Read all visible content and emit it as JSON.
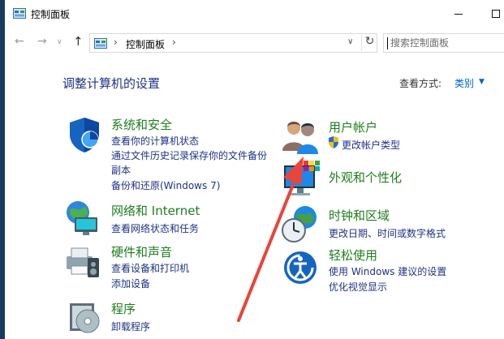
{
  "window": {
    "title": "控制面板",
    "title_icon": "control-panel-icon",
    "controls": [
      "minimize-icon",
      "maximize-icon"
    ]
  },
  "navigation": {
    "back_icon": "back-arrow-icon",
    "forward_icon": "forward-arrow-icon",
    "up_icon": "up-arrow-icon",
    "breadcrumb": "控制面板",
    "search_placeholder": "搜索控制面板"
  },
  "main": {
    "heading": "调整计算机的设置",
    "view_by_label": "查看方式:",
    "view_by_value": "类别"
  },
  "left_categories": [
    {
      "icon": "shield-icon",
      "title": "系统和安全",
      "links": [
        "查看你的计算机状态",
        "通过文件历史记录保存你的文件备份",
        "副本",
        "备份和还原(Windows 7)"
      ]
    },
    {
      "icon": "network-globe-icon",
      "title": "网络和 Internet",
      "links": [
        "查看网络状态和任务"
      ]
    },
    {
      "icon": "printer-speaker-icon",
      "title": "硬件和声音",
      "links": [
        "查看设备和打印机",
        "添加设备"
      ]
    },
    {
      "icon": "programs-disc-icon",
      "title": "程序",
      "links": [
        "卸载程序"
      ]
    }
  ],
  "right_categories": [
    {
      "icon": "users-icon",
      "title": "用户帐户",
      "links": [
        "更改帐户类型"
      ],
      "link_icon": "uac-shield-icon"
    },
    {
      "icon": "monitor-personalize-icon",
      "title": "外观和个性化",
      "links": []
    },
    {
      "icon": "clock-globe-icon",
      "title": "时钟和区域",
      "links": [
        "更改日期、时间或数字格式"
      ]
    },
    {
      "icon": "ease-of-access-icon",
      "title": "轻松使用",
      "links": [
        "使用 Windows 建议的设置",
        "优化视觉显示"
      ]
    }
  ],
  "colors": {
    "category_title": "#1e7e1e",
    "link": "#1e3287",
    "heading": "#1e3287",
    "view_value": "#0066cc",
    "annotation_arrow": "#e8453c",
    "desktop_background": "#1a3b60"
  }
}
